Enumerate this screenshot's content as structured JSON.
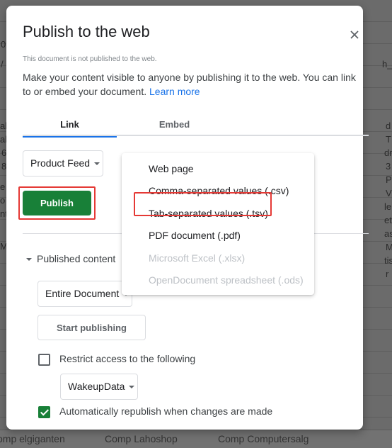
{
  "background": {
    "fragments_left": [
      "0",
      "/",
      "ak",
      "ak",
      "6",
      "8",
      "e",
      "o",
      "nt",
      "M"
    ],
    "fragments_right": [
      "h_",
      "d",
      "T",
      "dr",
      "3",
      "P",
      "V",
      "le",
      "et",
      "as",
      "M",
      "tis",
      "r"
    ],
    "sheet_tabs": [
      "omp elgiganten",
      "Comp Lahoshop",
      "Comp Computersalg"
    ]
  },
  "dialog": {
    "title": "Publish to the web",
    "close_icon": "close-icon",
    "status_note": "This document is not published to the web.",
    "description": "Make your content visible to anyone by publishing it to the web. You can link to or embed your document.",
    "learn_more": "Learn more",
    "tabs": [
      {
        "label": "Link",
        "active": true
      },
      {
        "label": "Embed",
        "active": false
      }
    ],
    "sheet_select": {
      "value": "Product Feed"
    },
    "publish_button": "Publish",
    "format_menu": {
      "items": [
        {
          "label": "Web page",
          "enabled": true
        },
        {
          "label": "Comma-separated values (.csv)",
          "enabled": true
        },
        {
          "label": "Tab-separated values (.tsv)",
          "enabled": true,
          "highlighted": true
        },
        {
          "label": "PDF document (.pdf)",
          "enabled": true
        },
        {
          "label": "Microsoft Excel (.xlsx)",
          "enabled": false
        },
        {
          "label": "OpenDocument spreadsheet (.ods)",
          "enabled": false
        }
      ]
    },
    "published_content": {
      "toggle_label": "Published content & settings",
      "toggle_label_visible": "Published content",
      "document_select": {
        "value": "Entire Document"
      },
      "start_button": "Start publishing",
      "restrict_access": {
        "label": "Restrict access to the following",
        "checked": false
      },
      "domain_select": {
        "value": "WakeupData"
      },
      "auto_republish": {
        "label": "Automatically republish when changes are made",
        "checked": true
      }
    }
  },
  "colors": {
    "primary_green": "#188038",
    "link_blue": "#1a73e8",
    "highlight_red": "#e53935",
    "overlay": "#6b6b6b"
  }
}
